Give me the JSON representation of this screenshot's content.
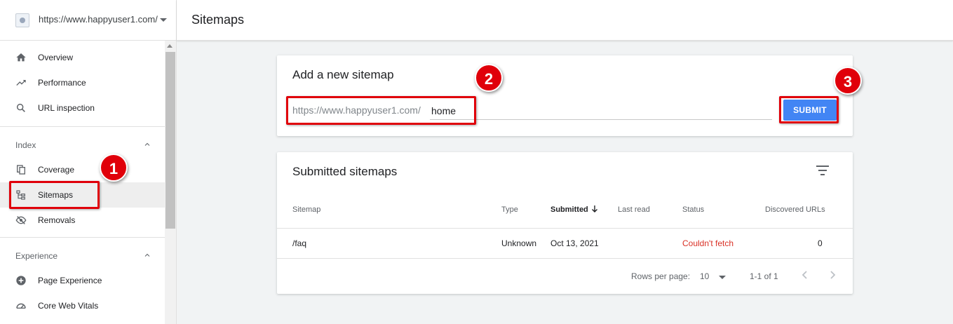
{
  "property": {
    "url": "https://www.happyuser1.com/"
  },
  "sidebar": {
    "items": [
      {
        "label": "Overview",
        "icon": "home-icon"
      },
      {
        "label": "Performance",
        "icon": "trending-up-icon"
      },
      {
        "label": "URL inspection",
        "icon": "search-icon"
      }
    ],
    "index_section": {
      "label": "Index",
      "items": [
        {
          "label": "Coverage",
          "icon": "copy-icon"
        },
        {
          "label": "Sitemaps",
          "icon": "sitemap-icon",
          "active": true
        },
        {
          "label": "Removals",
          "icon": "eye-off-icon"
        }
      ]
    },
    "experience_section": {
      "label": "Experience",
      "items": [
        {
          "label": "Page Experience",
          "icon": "plus-circle-icon"
        },
        {
          "label": "Core Web Vitals",
          "icon": "gauge-icon"
        }
      ]
    }
  },
  "header": {
    "title": "Sitemaps"
  },
  "add_sitemap": {
    "title": "Add a new sitemap",
    "url_prefix": "https://www.happyuser1.com/",
    "input_value": "home",
    "submit_label": "SUBMIT"
  },
  "submitted": {
    "title": "Submitted sitemaps",
    "columns": [
      "Sitemap",
      "Type",
      "Submitted",
      "Last read",
      "Status",
      "Discovered URLs"
    ],
    "rows": [
      {
        "sitemap": "/faq",
        "type": "Unknown",
        "submitted": "Oct 13, 2021",
        "last_read": "",
        "status": "Couldn't fetch",
        "discovered": "0"
      }
    ],
    "rows_per_page_label": "Rows per page:",
    "rows_per_page": "10",
    "range": "1-1 of 1"
  },
  "annotations": {
    "one": "1",
    "two": "2",
    "three": "3"
  },
  "colors": {
    "accent": "#4285f4",
    "error": "#d93025",
    "annotation": "#e0000a"
  }
}
